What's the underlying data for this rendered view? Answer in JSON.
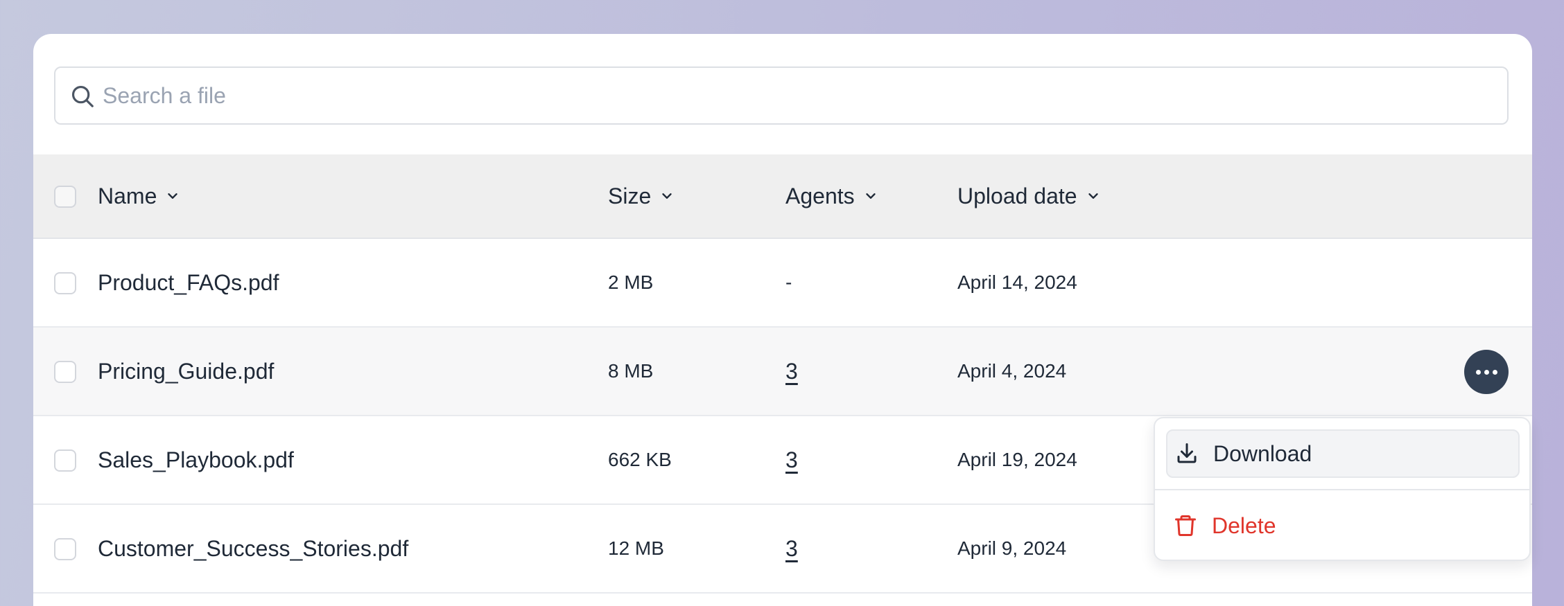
{
  "search": {
    "icon": "search-icon",
    "placeholder": "Search a file",
    "value": ""
  },
  "table": {
    "columns": [
      {
        "label": "Name",
        "sort_icon": "chevron-down-icon"
      },
      {
        "label": "Size",
        "sort_icon": "chevron-down-icon"
      },
      {
        "label": "Agents",
        "sort_icon": "chevron-down-icon"
      },
      {
        "label": "Upload date",
        "sort_icon": "chevron-down-icon"
      }
    ],
    "rows": [
      {
        "name": "Product_FAQs.pdf",
        "size": "2 MB",
        "agents": "-",
        "upload_date": "April 14, 2024"
      },
      {
        "name": "Pricing_Guide.pdf",
        "size": "8 MB",
        "agents": "3",
        "upload_date": "April 4, 2024"
      },
      {
        "name": "Sales_Playbook.pdf",
        "size": "662 KB",
        "agents": "3",
        "upload_date": "April 19, 2024"
      },
      {
        "name": "Customer_Success_Stories.pdf",
        "size": "12 MB",
        "agents": "3",
        "upload_date": "April 9, 2024"
      }
    ]
  },
  "row_actions": {
    "icon": "more-horizontal-icon",
    "menu": {
      "download": {
        "label": "Download",
        "icon": "download-icon"
      },
      "delete": {
        "label": "Delete",
        "icon": "trash-icon",
        "color": "#e0352b"
      }
    }
  },
  "colors": {
    "accent_dark": "#334155",
    "danger": "#e0352b",
    "header_bg": "#efefef",
    "hover_row_bg": "#f7f7f8"
  }
}
